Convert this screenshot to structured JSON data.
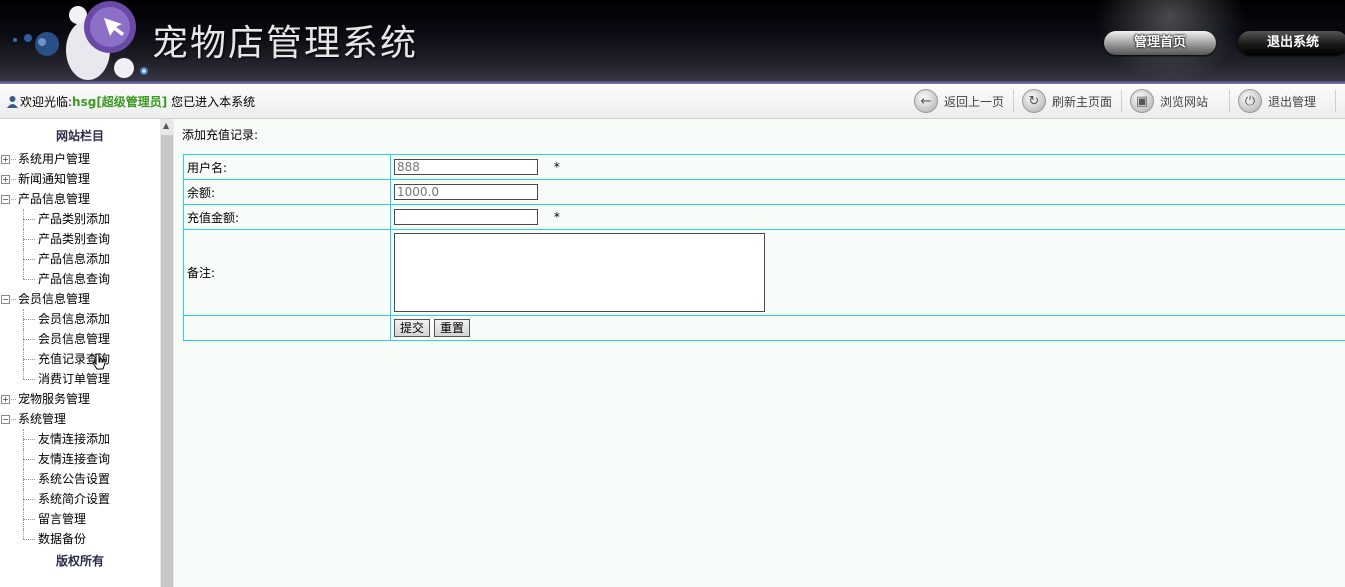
{
  "header": {
    "title": "宠物店管理系统",
    "home_button": "管理首页",
    "logout_button": "退出系统"
  },
  "topbar": {
    "welcome_prefix": "欢迎光临:",
    "username": "hsg[超级管理员]",
    "welcome_suffix": "您已进入本系统",
    "back_label": "返回上一页",
    "refresh_label": "刷新主页面",
    "browse_label": "浏览网站",
    "exit_label": "退出管理"
  },
  "sidebar": {
    "title": "网站栏目",
    "footer": "版权所有",
    "groups": [
      {
        "label": "系统用户管理",
        "expanded": false,
        "children": []
      },
      {
        "label": "新闻通知管理",
        "expanded": false,
        "children": []
      },
      {
        "label": "产品信息管理",
        "expanded": true,
        "children": [
          "产品类别添加",
          "产品类别查询",
          "产品信息添加",
          "产品信息查询"
        ]
      },
      {
        "label": "会员信息管理",
        "expanded": true,
        "children": [
          "会员信息添加",
          "会员信息管理",
          "充值记录查询",
          "消费订单管理"
        ]
      },
      {
        "label": "宠物服务管理",
        "expanded": false,
        "children": []
      },
      {
        "label": "系统管理",
        "expanded": true,
        "children": [
          "友情连接添加",
          "友情连接查询",
          "系统公告设置",
          "系统简介设置",
          "留言管理",
          "数据备份"
        ]
      }
    ]
  },
  "form": {
    "title": "添加充值记录:",
    "username_label": "用户名:",
    "username_value": "888",
    "balance_label": "余额:",
    "balance_value": "1000.0",
    "amount_label": "充值金额:",
    "amount_value": "",
    "remark_label": "备注:",
    "remark_value": "",
    "required_mark": "*",
    "submit_label": "提交",
    "reset_label": "重置"
  },
  "colors": {
    "table_border": "#29d2e6",
    "main_background": "#f7fcf9",
    "username_color": "#3c9a22"
  }
}
